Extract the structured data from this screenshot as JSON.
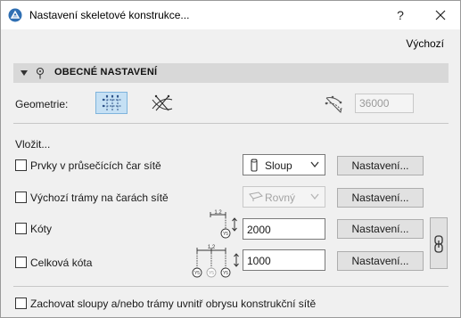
{
  "window": {
    "title": "Nastavení skeletové konstrukce...",
    "help_label": "?",
    "defaults_label": "Výchozí"
  },
  "section": {
    "title": "OBECNÉ NASTAVENÍ"
  },
  "geometry": {
    "label": "Geometrie:",
    "selected": "rectangular-grid",
    "angle_value": "36000"
  },
  "insert": {
    "label": "Vložit...",
    "rows": [
      {
        "label": "Prvky v průsečících čar sítě",
        "checked": false,
        "select_value": "Sloup",
        "select_icon": "column-icon",
        "button": "Nastavení..."
      },
      {
        "label": "Výchozí trámy na čarách sítě",
        "checked": false,
        "select_value": "Rovný",
        "select_icon": "beam-icon",
        "select_disabled": true,
        "button": "Nastavení..."
      },
      {
        "label": "Kóty",
        "checked": false,
        "value": "2000",
        "dim_numbers": [
          "1.2"
        ],
        "grid_bubbles": [
          "Y5"
        ],
        "button": "Nastavení..."
      },
      {
        "label": "Celková kóta",
        "checked": false,
        "value": "1000",
        "dim_numbers": [
          "1.2"
        ],
        "grid_bubbles": [
          "Y5",
          "Y5",
          "Y5"
        ],
        "button": "Nastavení..."
      }
    ],
    "keep_label": "Zachovat sloupy a/nebo trámy uvnitř obrysu konstrukční sítě",
    "keep_checked": false
  },
  "colors": {
    "accent_selected": "#c5e0f4",
    "section_bg": "#d8d8d8",
    "dialog_bg": "#f0f0f0"
  }
}
